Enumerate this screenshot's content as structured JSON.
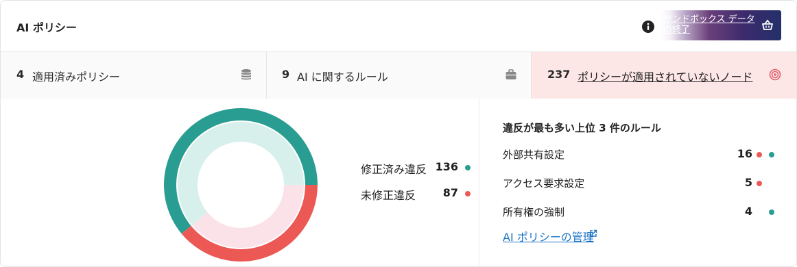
{
  "header": {
    "title": "AI ポリシー",
    "info_icon": "info-icon",
    "promo_text": "サンドボックス データの終了",
    "promo_icon": "basket-icon"
  },
  "stats": [
    {
      "value": "4",
      "label": "適用済みポリシー",
      "icon": "database-icon"
    },
    {
      "value": "9",
      "label": "AI に関するルール",
      "icon": "briefcase-icon"
    },
    {
      "value": "237",
      "label": "ポリシーが適用されていないノード",
      "icon": "target-icon"
    }
  ],
  "chart_data": {
    "type": "pie",
    "labels": [
      "修正済み違反",
      "未修正違反"
    ],
    "values": [
      136,
      87
    ],
    "colors": [
      "#2a9d92",
      "#ec5955"
    ],
    "light_colors": [
      "#d8f0ec",
      "#fbe2e8"
    ],
    "legend_placement": "right"
  },
  "violations": [
    {
      "label": "修正済み違反",
      "value": "136"
    },
    {
      "label": "未修正違反",
      "value": "87"
    }
  ],
  "top_rules": {
    "title": "違反が最も多い上位 3 件のルール",
    "items": [
      {
        "label": "外部共有設定",
        "value": "16",
        "unresolved": true,
        "resolved": true
      },
      {
        "label": "アクセス要求設定",
        "value": "5",
        "unresolved": true,
        "resolved": false
      },
      {
        "label": "所有権の強制",
        "value": "4",
        "unresolved": false,
        "resolved": true
      }
    ],
    "manage_link": "AI ポリシーの管理",
    "manage_icon": "external-link-icon"
  }
}
